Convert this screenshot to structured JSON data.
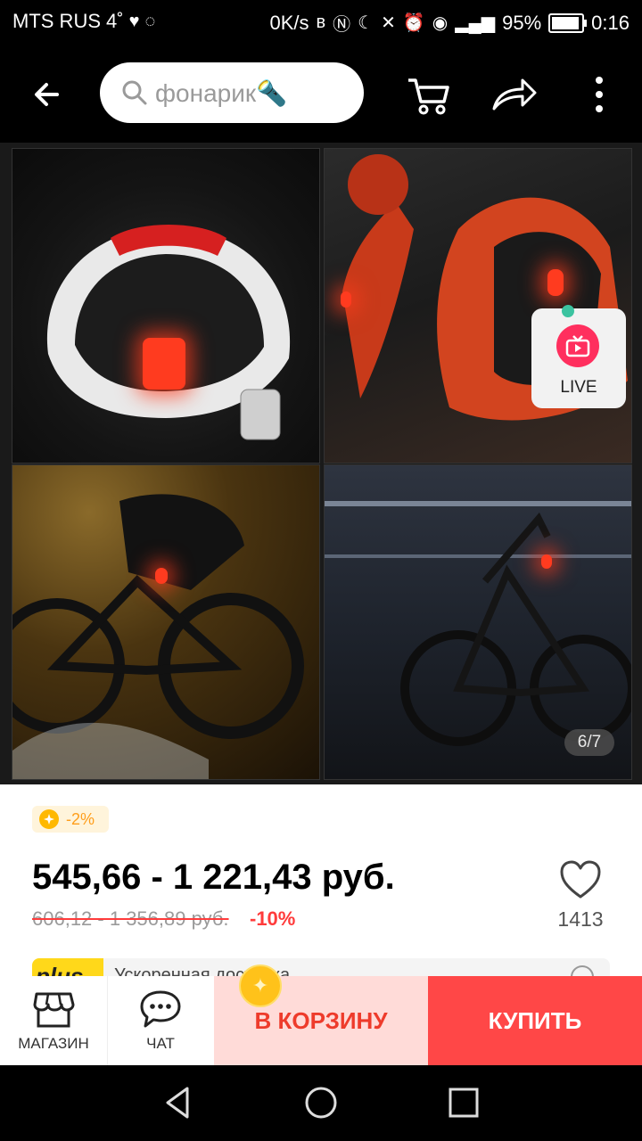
{
  "status_bar": {
    "carrier": "MTS RUS",
    "temperature": "4˚",
    "speed": "0K/s",
    "battery_pct": "95%",
    "battery_level": 0.95,
    "time": "0:16"
  },
  "header": {
    "search_text": "фонарик🔦",
    "icons": [
      "back-arrow-icon",
      "search-icon",
      "cart-icon",
      "share-icon",
      "more-icon"
    ]
  },
  "gallery": {
    "live_label": "LIVE",
    "counter": "6/7"
  },
  "product": {
    "coin_discount": "-2%",
    "price": "545,66 - 1 221,43 руб.",
    "old_price": "606,12 - 1 356,89 руб.",
    "discount": "-10%",
    "favorites": "1413",
    "plus_logo": "plus",
    "plus_text": "Ускоренная доставка"
  },
  "bottom_bar": {
    "store_label": "МАГАЗИН",
    "chat_label": "ЧАТ",
    "cart_label": "В КОРЗИНУ",
    "buy_label": "КУПИТЬ"
  },
  "colors": {
    "accent": "#ff4747",
    "cart_bg": "#ffdbd8",
    "badge_text": "#ff9e1b",
    "live": "#ff2f5e"
  }
}
